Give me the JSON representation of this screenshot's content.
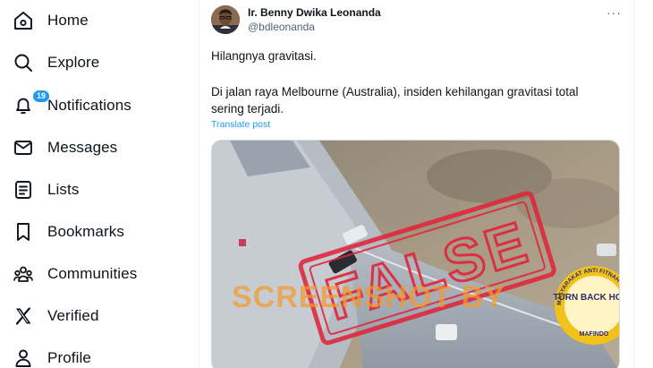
{
  "nav": {
    "items": [
      {
        "label": "Home",
        "icon": "home-icon"
      },
      {
        "label": "Explore",
        "icon": "search-icon"
      },
      {
        "label": "Notifications",
        "icon": "bell-icon",
        "badge": "19"
      },
      {
        "label": "Messages",
        "icon": "envelope-icon"
      },
      {
        "label": "Lists",
        "icon": "list-icon"
      },
      {
        "label": "Bookmarks",
        "icon": "bookmark-icon"
      },
      {
        "label": "Communities",
        "icon": "people-icon"
      },
      {
        "label": "Verified",
        "icon": "x-logo-icon"
      },
      {
        "label": "Profile",
        "icon": "person-icon"
      }
    ]
  },
  "post": {
    "author_name": "Ir. Benny Dwika Leonanda",
    "author_handle": "@bdleonanda",
    "more_label": "···",
    "line1": "Hilangnya gravitasi.",
    "line2": "Di jalan raya Melbourne (Australia), insiden kehilangan gravitasi total sering terjadi.",
    "translate_label": "Translate post"
  },
  "media": {
    "stamp_text": "FALSE",
    "watermark_text": "SCREENSHOT BY",
    "seal_text": "TURN BACK HOAX",
    "seal_ring_text": "MASYARAKAT ANTI FITNAH INDONESIA",
    "seal_bottom_text": "MAFINDO"
  },
  "colors": {
    "accent": "#1d9bf0",
    "stamp_red": "#e0243a",
    "watermark_orange": "#f59a2a",
    "seal_gold": "#f2c21b"
  }
}
